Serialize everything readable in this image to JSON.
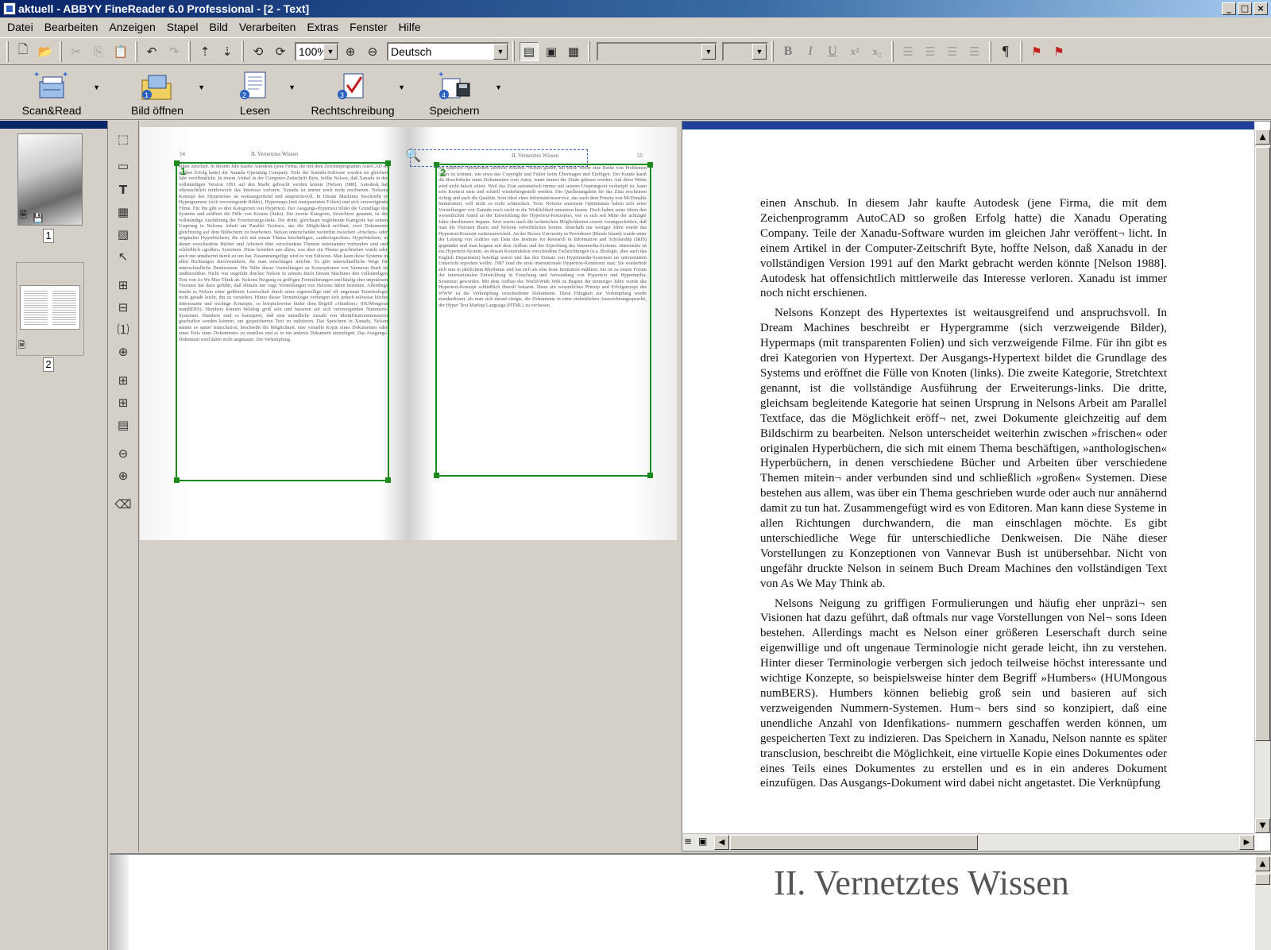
{
  "window": {
    "title": "aktuell - ABBYY FineReader 6.0 Professional - [2 - Text]",
    "buttons": [
      "_",
      "□",
      "×"
    ]
  },
  "menu": [
    {
      "label": "Datei"
    },
    {
      "label": "Bearbeiten"
    },
    {
      "label": "Anzeigen"
    },
    {
      "label": "Stapel"
    },
    {
      "label": "Bild"
    },
    {
      "label": "Verarbeiten"
    },
    {
      "label": "Extras"
    },
    {
      "label": "Fenster"
    },
    {
      "label": "Hilfe"
    }
  ],
  "toolbar": {
    "zoom": "100%",
    "language": "Deutsch",
    "font_name": "",
    "font_size": "",
    "format": {
      "bold": "B",
      "italic": "I",
      "underline": "U",
      "superscript": "x²",
      "subscript": "x₂"
    },
    "pilcrow": "¶"
  },
  "bigtoolbar": {
    "scan_read": "Scan&Read",
    "open_image": "Bild öffnen",
    "read": "Lesen",
    "spellcheck": "Rechtschreibung",
    "save": "Speichern"
  },
  "thumbnails": [
    {
      "number": "1"
    },
    {
      "number": "2"
    }
  ],
  "scan": {
    "left_page_no": "54",
    "left_header": "II. Vernetztes Wissen",
    "right_header": "II. Vernetztes Wissen",
    "right_page_no": "55",
    "block1_no": "1",
    "block2_no": "2",
    "left_text": "einen Anschub. In diesem Jahr kaufte Autodesk (jene Firma, die mit dem Zeichenprogramm AutoCAD so großen Erfolg hatte) die Xanadu Operating Company. Teile der Xanadu-Software wurden im gleichen Jahr veröffentlicht. In einem Artikel in der Computer-Zeitschrift Byte, hoffte Nelson, daß Xanadu in der vollständigen Version 1991 auf den Markt gebracht werden könnte [Nelson 1988]. Autodesk hat offensichtlich mittlerweile das Interesse verloren. Xanadu ist immer noch nicht erschienen. Nelsons Konzept des Hypertextes ist weitausgreifend und anspruchsvoll. In Dream Machines beschreibt er Hypergramme (sich verzweigende Bilder), Hypermaps (mit transparenten Folien) und sich verzweigende Filme. Für ihn gibt es drei Kategorien von Hypertext. Der Ausgangs-Hypertext bildet die Grundlage des Systems und eröffnet die Fülle von Knoten (links). Die zweite Kategorie, Stretchtext genannt, ist die vollständige Ausführung der Erweiterungs-links. Die dritte, gleichsam begleitende Kategorie hat seinen Ursprung in Nelsons Arbeit am Parallel Textface, das die Möglichkeit eröffnet, zwei Dokumente gleichzeitig auf dem Bildschirm zu bearbeiten. Nelson unterscheidet weiterhin zwischen »frischen« oder originalen Hyperbüchern, die sich mit einem Thema beschäftigen, »anthologischen« Hyperbüchern, in denen verschiedene Bücher und Arbeiten über verschiedene Themen miteinander verbunden sind und schließlich »großen« Systemen. Diese bestehen aus allem, was über ein Thema geschrieben wurde oder auch nur annähernd damit zu tun hat. Zusammengefügt wird es von Editoren. Man kann diese Systeme in allen Richtungen durchwandern, die man einschlagen möchte. Es gibt unterschiedliche Wege für unterschiedliche Denkweisen. Die Nähe dieser Vorstellungen zu Konzeptionen von Vannevar Bush ist unübersehbar. Nicht von ungefähr druckte Nelson in seinem Buch Dream Machines den vollständigen Text von As We May Think ab. Nelsons Neigung zu griffigen Formulierungen und häufig eher unpräzisen Visionen hat dazu geführt, daß oftmals nur vage Vorstellungen von Nelsons Ideen bestehen. Allerdings macht es Nelson einer größeren Leserschaft durch seine eigenwillige und oft ungenaue Terminologie nicht gerade leicht, ihn zu verstehen. Hinter dieser Terminologie verbergen sich jedoch teilweise höchst interessante und wichtige Konzepte, so beispielsweise hinter dem Begriff »Humbers« (HUMongous numBERS). Humbers können beliebig groß sein und basieren auf sich verzweigenden Nummern-Systemen. Humbers sind so konzipiert, daß eine unendliche Anzahl von Identifikationsnummern geschaffen werden können, um gespeicherten Text zu indizieren. Das Speichern in Xanadu, Nelson nannte es später transclusion, beschreibt die Möglichkeit, eine virtuelle Kopie eines Dokumentes oder eines Teils eines Dokumentes zu erstellen und es in ein anderes Dokument einzufügen. Das Ausgangs-Dokument wird dabei nicht angetastet. Die Verknüpfung",
    "right_text": "bei späteren Operationen aufrecht erhalten. Nelson glaubt, auf diese Weise eine Reihe von Problemen lösen zu können, wie etwa das Copyright und Fehler beim Übertragen und Einfügen. Der Kunde kauft die Bruchstücke eines Dokumentes vom Autor, wann immer die Zitate gelesen werden. Auf diese Weise wird nicht falsch zitiert. Weil das Zitat automatisch immer mit seinem Ursprungsort verknüpft ist, kann sein Kontext stets und schnell wiederhergestellt werden. Die Quellenangaben für das Zitat erscheinen richtig und auch die Qualität. Sein Ideal eines Informationsservice, das nach dem Prinzip von McDonalds funktioniert, will nicht so recht schmecken. Trotz Nelsons enormem Optimismus haben sich seine Vorstellungen von Xanadu noch nicht in die Wirklichkeit umsetzen lassen. Doch haben seine Ideen den wesentlichen Anteil an der Entwicklung des Hypertext-Konzeptes, wie es sich seit Mitte der achtziger Jahre durchsetzen begann. Jetzt waren auch die technischen Möglichkeiten soweit vorangeschritten, daß man die Visionen Bushs und Nelsons verwirklichen konnte. Innerhalb nur weniger Jahre wurde das Hypertext-Konzept weiterentwickelt. An der Brown University in Providence (Rhode Island) wurde unter der Leitung von Andries van Dam das Institute for Research in Information and Scholarship (IRIS) gegründet und man begann mit dem Aufbau und der Erprobung des Intermedia-Systems. Intermedia ist ein Hypertext-System, an dessen Konstruktion verschiedene Fachrichtungen (u.a. Biologie, aber auch das English Department) beteiligt waren und das den Einsatz von Hypermedia-Systemen im universitären Unterricht erproben wollte. 1987 fand die erste internationale Hypertext-Konferenz statt. Sie wiederholt sich nun in jährlichem Rhythmus und hat sich als eine feste Institution etabliert. Sie ist zu einem Forum der internationalen Entwicklung in Forschung und Anwendung von Hypertext und Hypermedia-Systemen geworden. Mit dem Aufbau des World-Wide Web zu Beginn der neunziger Jahre wurde das Hypertext-Konzept schließlich überall bekannt. Denn ein wesentliches Prinzip und Erfolgsrezept des WWW ist die Verknüpfung verschiedener Dokumente. Diese Fähigkeit zur Verknüpfung wurde standardisiert, als man sich darauf einigte, die Dokumente in einer einheitlichen Auszeichnungssprache, der Hyper Text Markup Language (HTML) zu verfassen."
  },
  "document": {
    "p1": "einen Anschub. In diesem Jahr kaufte Autodesk (jene Firma, die mit dem Zeichenprogramm AutoCAD so großen Erfolg hatte) die Xanadu Operating Company. Teile der Xanadu-Software wurden im gleichen Jahr veröffent¬ licht. In einem Artikel in der Computer-Zeitschrift Byte, hoffte Nelson, daß Xanadu in der vollständigen Version 1991 auf den Markt gebracht werden könnte [Nelson 1988]. Autodesk hat offensichtlich mittlerweile das Interesse verloren. Xanadu ist immer noch nicht erschienen.",
    "p2": "Nelsons Konzept des Hypertextes ist weitausgreifend und anspruchsvoll. In Dream Machines beschreibt er Hypergramme (sich verzweigende Bilder), Hypermaps (mit transparenten Folien) und sich verzweigende Filme. Für ihn gibt es drei Kategorien von Hypertext. Der Ausgangs-Hypertext bildet die Grundlage des Systems und eröffnet die Fülle von Knoten (links). Die zweite Kategorie, Stretchtext genannt, ist die vollständige Ausführung der Erweiterungs-links. Die dritte, gleichsam begleitende Kategorie hat seinen Ursprung in Nelsons Arbeit am Parallel Textface, das die Möglichkeit eröff¬ net, zwei Dokumente gleichzeitig auf dem Bildschirm zu bearbeiten. Nelson unterscheidet weiterhin zwischen »frischen« oder originalen Hyperbüchern, die sich mit einem Thema beschäftigen, »anthologischen« Hyperbüchern, in denen verschiedene Bücher und Arbeiten über verschiedene Themen mitein¬ ander verbunden sind und schließlich »großen« Systemen. Diese bestehen aus allem, was über ein Thema geschrieben wurde oder auch nur annähernd damit zu tun hat. Zusammengefügt wird es von Editoren. Man kann diese Systeme in allen Richtungen durchwandern, die man einschlagen möchte. Es gibt unterschiedliche Wege für unterschiedliche Denkweisen. Die Nähe dieser Vorstellungen zu Konzeptionen von Vannevar Bush ist unübersehbar. Nicht von ungefähr druckte Nelson in seinem Buch Dream Machines den vollständigen Text von As We May Think ab.",
    "p3": "Nelsons Neigung zu griffigen Formulierungen und häufig eher unpräzi¬ sen Visionen hat dazu geführt, daß oftmals nur vage Vorstellungen von Nel¬ sons Ideen bestehen. Allerdings macht es Nelson einer größeren Leserschaft durch seine eigenwillige und oft ungenaue Terminologie nicht gerade leicht, ihn zu verstehen. Hinter dieser Terminologie verbergen sich jedoch teilweise höchst interessante und wichtige Konzepte, so beispielsweise hinter dem Begriff »Humbers« (HUMongous numBERS). Humbers können beliebig groß sein und basieren auf sich verzweigenden Nummern-Systemen. Hum¬ bers sind so konzipiert, daß eine unendliche Anzahl von Idenfikations- nummern geschaffen werden können, um gespeicherten Text zu indizieren. Das Speichern in Xanadu, Nelson nannte es später transclusion, beschreibt die Möglichkeit, eine virtuelle Kopie eines Dokumentes oder eines Teils eines Dokumentes zu erstellen und es in ein anderes Dokument einzufügen. Das Ausgangs-Dokument wird dabei nicht angetastet. Die Verknüpfung"
  },
  "zoom_window": {
    "heading": "II. Vernetztes Wissen"
  },
  "colors": {
    "title_gradient_start": "#0a246a",
    "block_frame": "#1d8a1d",
    "uncertain_highlight": "#7ff4f4"
  }
}
